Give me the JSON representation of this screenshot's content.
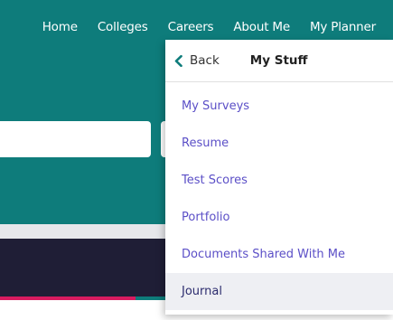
{
  "topnav": {
    "links": [
      "Home",
      "Colleges",
      "Careers",
      "About Me",
      "My Planner"
    ]
  },
  "dropdown": {
    "back_label": "Back",
    "title": "My Stuff",
    "items": [
      "My Surveys",
      "Resume",
      "Test Scores",
      "Portfolio",
      "Documents Shared With Me",
      "Journal"
    ],
    "active_item": "Journal"
  },
  "colors": {
    "teal": "#0e7c7b",
    "link_purple": "#5b4fc7",
    "dark_band": "#1f1e36",
    "accent_pink": "#d81b60"
  },
  "icons": {
    "back": "chevron-left-icon"
  }
}
